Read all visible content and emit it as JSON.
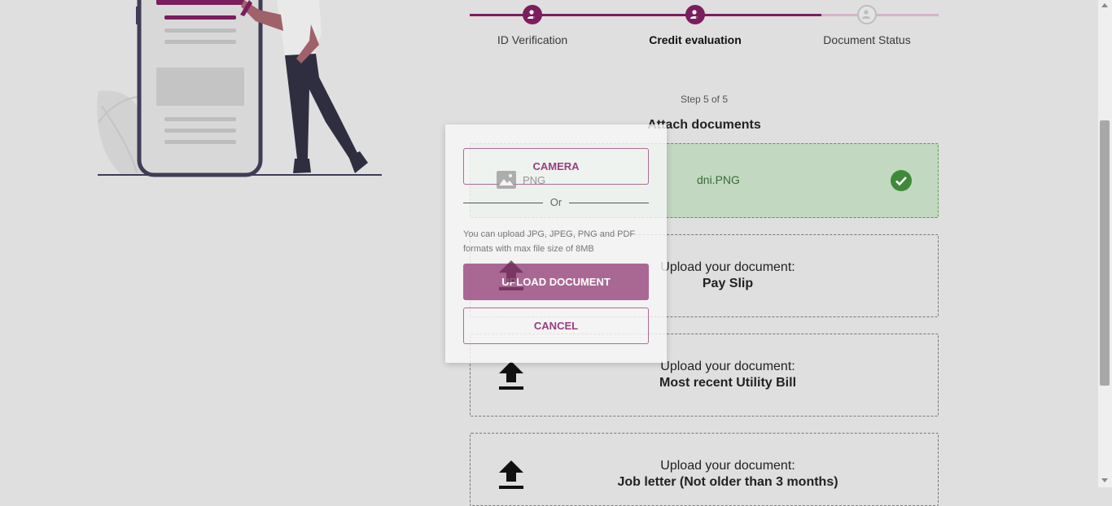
{
  "stepper": {
    "steps": [
      {
        "label": "ID Verification",
        "status": "done"
      },
      {
        "label": "Credit evaluation",
        "status": "active"
      },
      {
        "label": "Document Status",
        "status": "pending"
      }
    ]
  },
  "step_count": "Step 5 of 5",
  "section_title": "Attach documents",
  "uploads": [
    {
      "file_name": "dni.PNG",
      "status": "uploaded"
    },
    {
      "prompt": "Upload your document:",
      "doc": "Pay Slip"
    },
    {
      "prompt": "Upload your document:",
      "doc": "Most recent Utility Bill"
    },
    {
      "prompt": "Upload your document:",
      "doc": "Job letter (Not older than 3 months)"
    }
  ],
  "modal": {
    "camera_label": "CAMERA",
    "or_label": "Or",
    "note": "You can upload JPG, JPEG, PNG and PDF formats with max file size of 8MB",
    "upload_label": "UPLOAD DOCUMENT",
    "cancel_label": "CANCEL",
    "file_type": "PNG"
  },
  "colors": {
    "brand": "#7b1d5e",
    "success": "#3f8a3a",
    "success_bg": "#c2d8c0"
  }
}
